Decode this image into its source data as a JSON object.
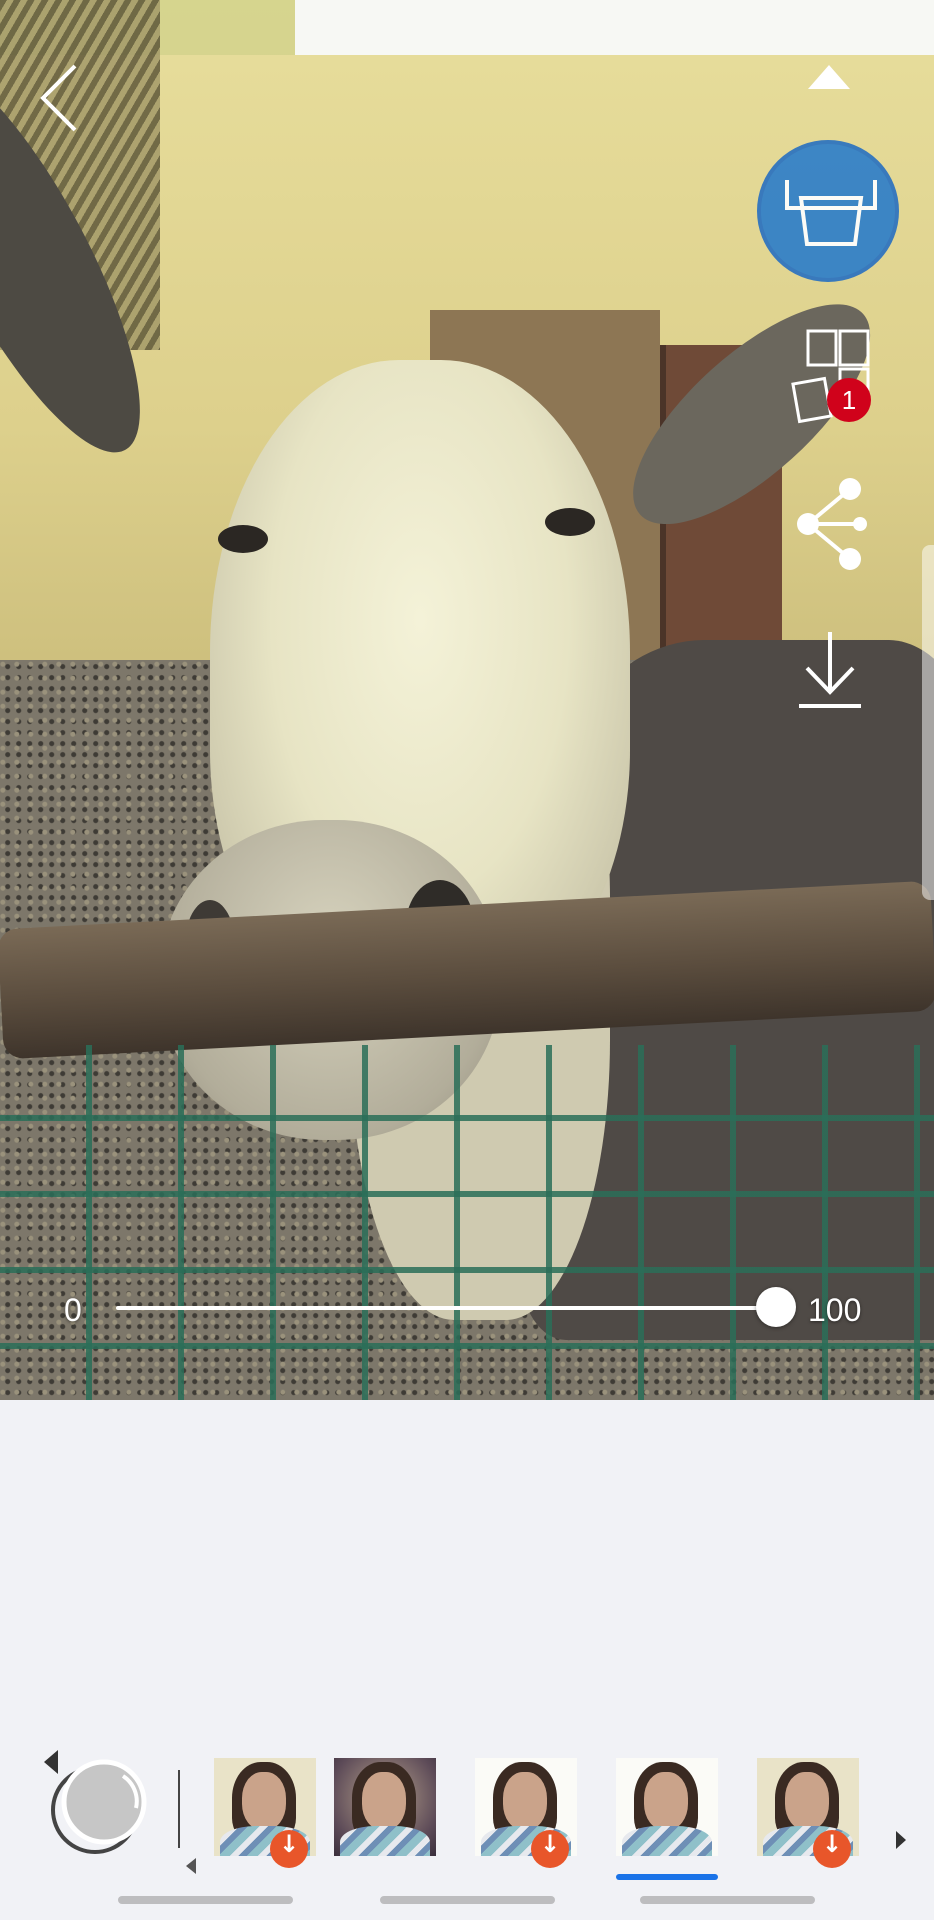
{
  "toolbar": {
    "back_icon": "chevron-left-icon",
    "collapse_icon": "triangle-up-icon",
    "print_icon": "printer-icon",
    "print_color": "#2f7fc9",
    "tile_icon": "photo-tile-icon",
    "queue_badge_count": "1",
    "share_icon": "share-icon",
    "download_icon": "download-icon"
  },
  "intensity_slider": {
    "min_label": "0",
    "max_label": "100",
    "value": 100
  },
  "filters": {
    "lens_icon": "lens-icon",
    "items": [
      {
        "style": "warm",
        "downloadable": true,
        "selected": false
      },
      {
        "style": "dark-vignette",
        "downloadable": false,
        "selected": false
      },
      {
        "style": "bright",
        "downloadable": true,
        "selected": false
      },
      {
        "style": "bright-vivid",
        "downloadable": false,
        "selected": true
      },
      {
        "style": "warm-soft",
        "downloadable": true,
        "selected": false
      }
    ],
    "download_badge_color": "#e8562a",
    "selected_color": "#1a73e8"
  }
}
